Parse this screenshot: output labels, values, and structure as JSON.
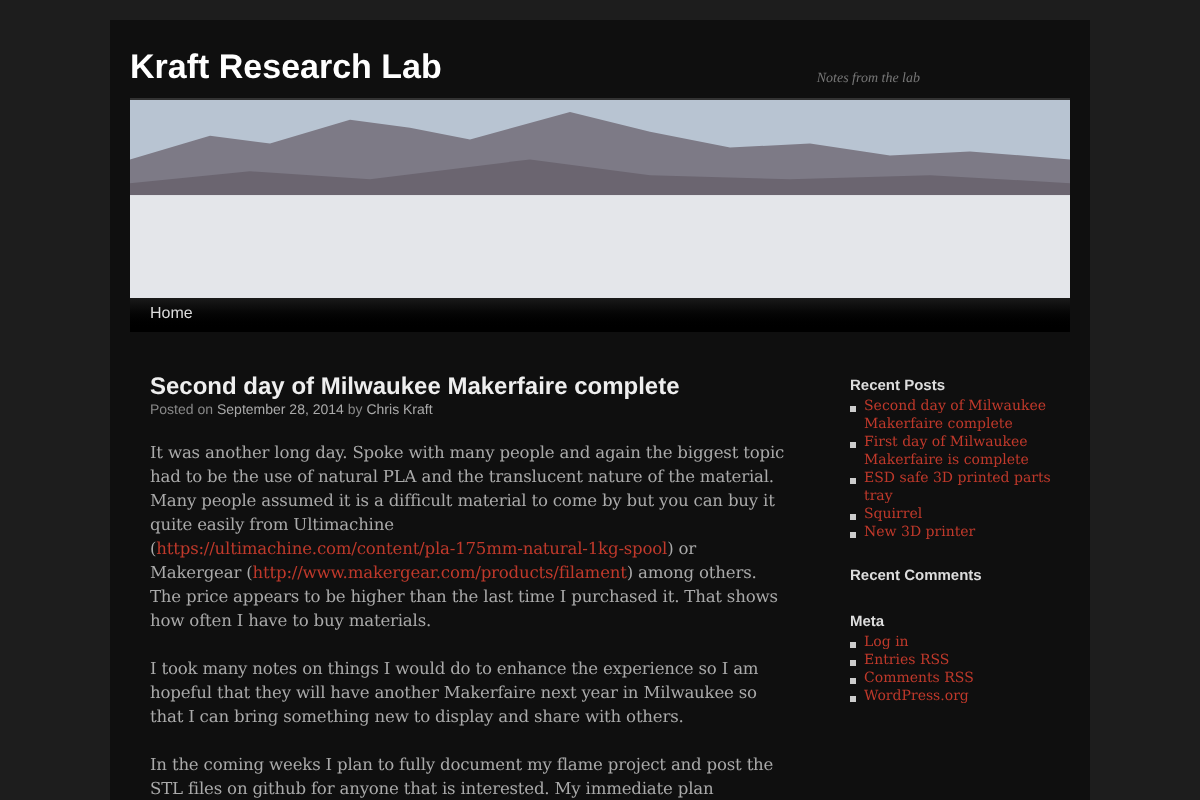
{
  "site": {
    "title": "Kraft Research Lab",
    "tagline": "Notes from the lab"
  },
  "nav": [
    {
      "label": "Home",
      "selected": false
    }
  ],
  "post": {
    "title": "Second day of Milwaukee Makerfaire complete",
    "meta_prefix": "Posted on",
    "date": "September 28, 2014",
    "meta_by": "by",
    "author": "Chris Kraft",
    "paragraphs": [
      [
        {
          "kind": "text",
          "text": "It was another long day. Spoke with many people and again the biggest topic had to be the use of natural PLA and the translucent nature of the material. Many people assumed it is a difficult material to come by but you can buy it quite easily from Ultimachine ("
        },
        {
          "kind": "link",
          "text": "https://ultimachine.com/content/pla-175mm-natural-1kg-spool"
        },
        {
          "kind": "text",
          "text": ") or Makergear ("
        },
        {
          "kind": "link",
          "text": "http://www.makergear.com/products/filament"
        },
        {
          "kind": "text",
          "text": ") among others. The price appears to be higher than the last time I purchased it. That shows how often I have to buy materials."
        }
      ],
      [
        {
          "kind": "text",
          "text": "I took many notes on things I would do to enhance the experience so I am hopeful that they will have another Makerfaire next year in Milwaukee so that I can bring something new to display and share with others."
        }
      ],
      [
        {
          "kind": "text",
          "text": "In the coming weeks I plan to fully document my flame project and post the STL files on github for anyone that is interested. My immediate plan"
        }
      ]
    ]
  },
  "sidebar": [
    {
      "title": "Recent Posts",
      "items": [
        "Second day of Milwaukee Makerfaire complete",
        "First day of Milwaukee Makerfaire is complete",
        "ESD safe 3D printed parts tray",
        "Squirrel",
        "New 3D printer"
      ]
    },
    {
      "title": "Recent Comments"
    },
    {
      "title": "Meta",
      "items": [
        "Log in",
        "Entries RSS",
        "Comments RSS",
        "WordPress.org"
      ]
    }
  ]
}
